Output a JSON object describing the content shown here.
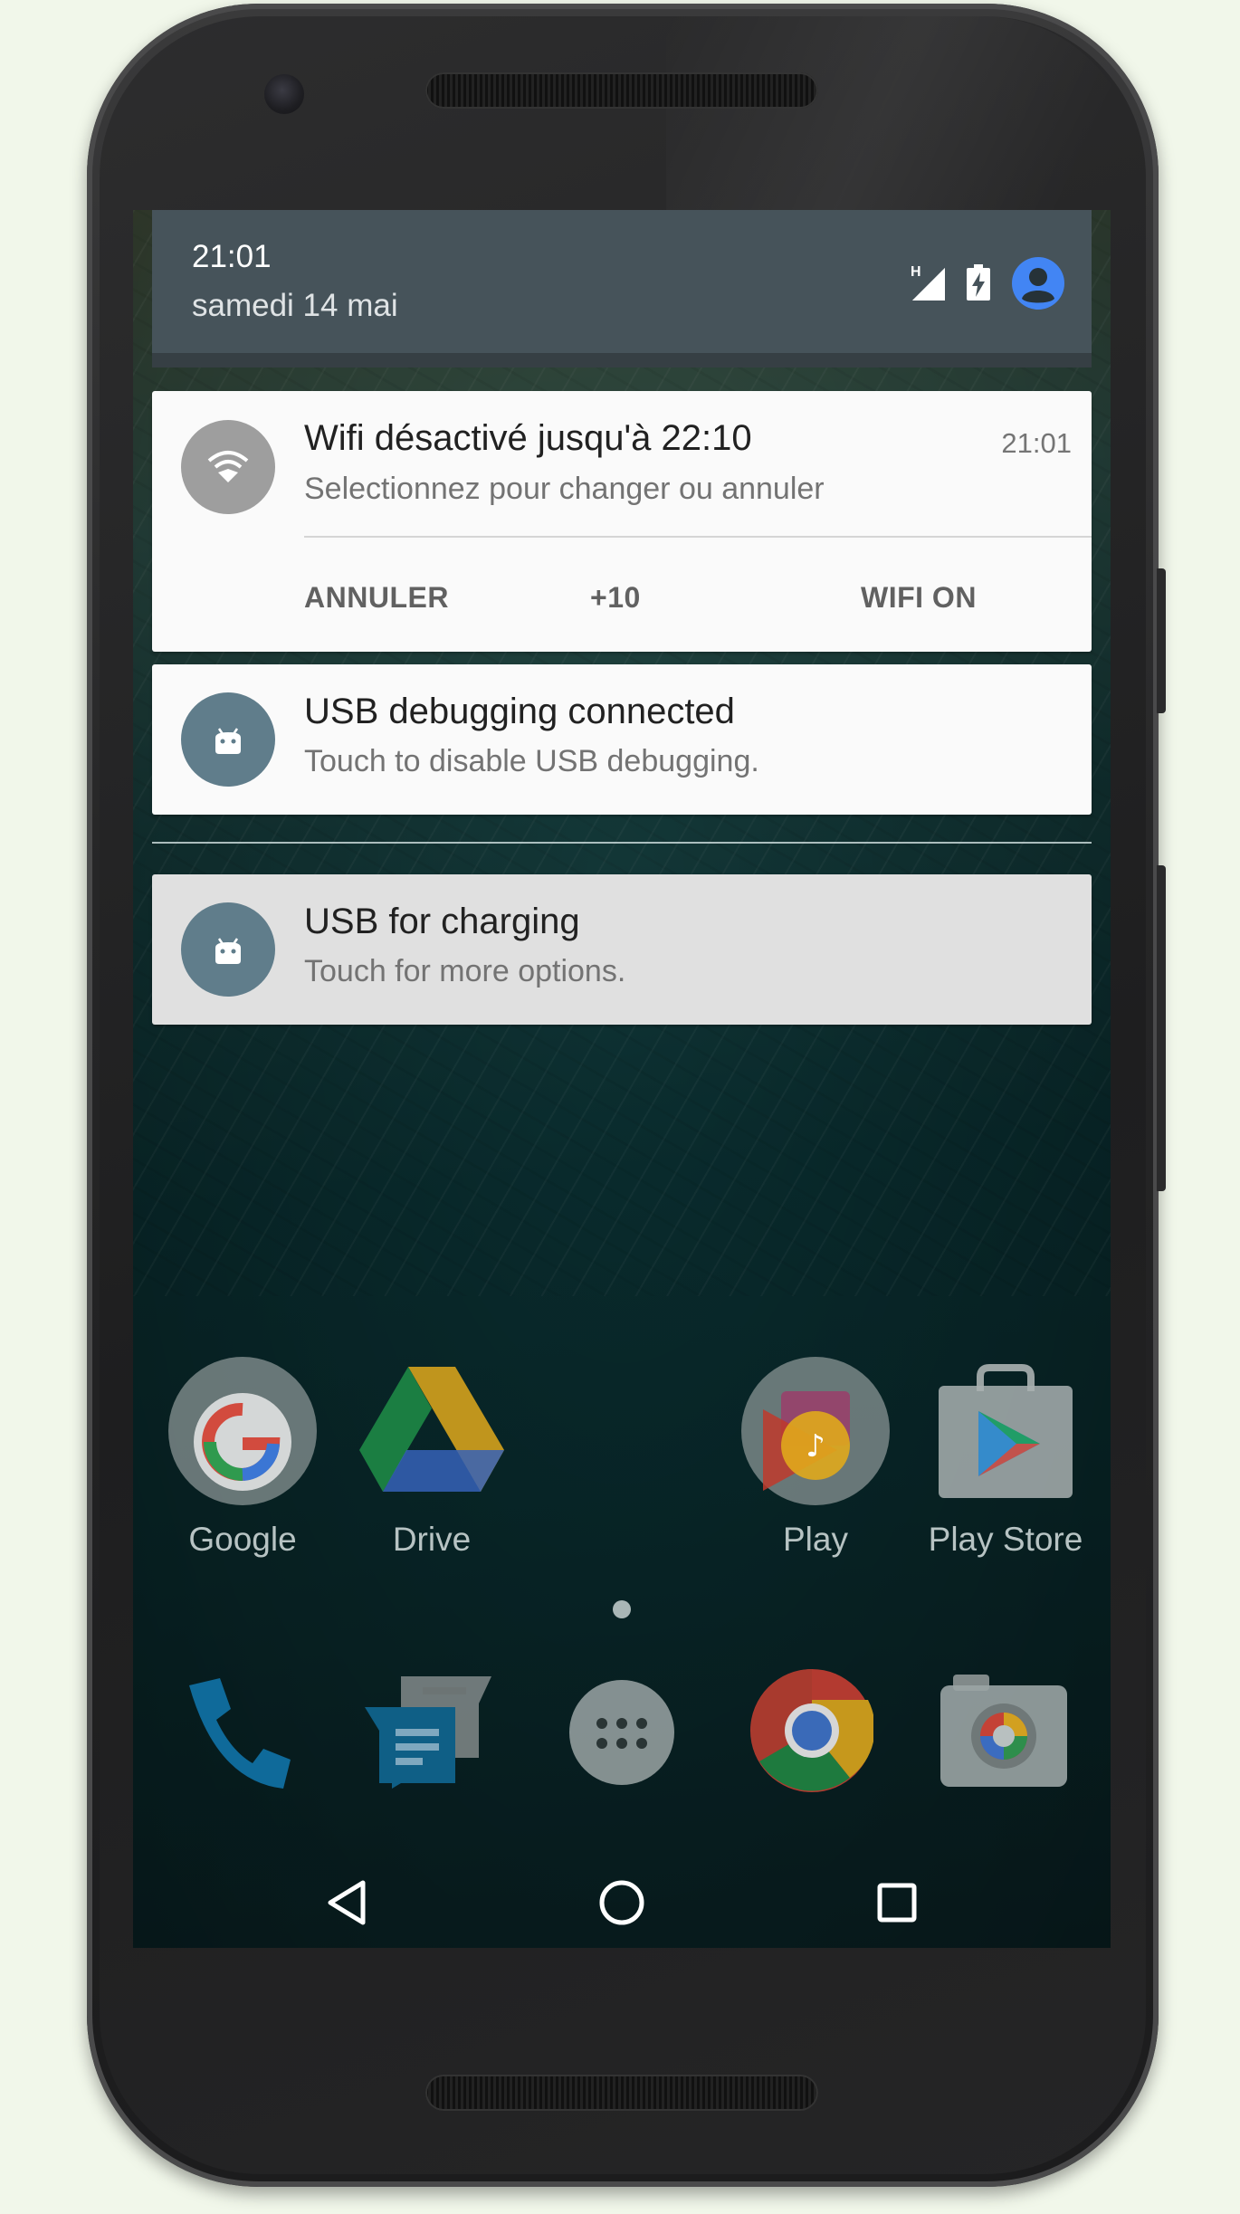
{
  "status_bar": {
    "time": "21:01",
    "date": "samedi 14 mai",
    "network_type": "H",
    "icons": [
      "signal-icon",
      "battery-charging-icon",
      "account-avatar-icon"
    ]
  },
  "notifications": [
    {
      "title": "Wifi désactivé jusqu'à 22:10",
      "text": "Selectionnez pour changer ou annuler",
      "time": "21:01",
      "icon": "wifi-off-icon",
      "actions": [
        "ANNULER",
        "+10",
        "WIFI ON"
      ]
    },
    {
      "title": "USB debugging connected",
      "text": "Touch to disable USB debugging.",
      "icon": "android-icon"
    },
    {
      "title": "USB for charging",
      "text": "Touch for more options.",
      "icon": "android-icon"
    }
  ],
  "home_apps": [
    {
      "label": "Google",
      "icon": "google-folder-icon"
    },
    {
      "label": "Drive",
      "icon": "drive-icon"
    },
    {
      "label": "Play",
      "icon": "play-folder-icon"
    },
    {
      "label": "Play Store",
      "icon": "play-store-icon"
    }
  ],
  "dock": [
    "phone-icon",
    "messenger-icon",
    "app-drawer-icon",
    "chrome-icon",
    "camera-icon"
  ],
  "navigation": [
    "back-icon",
    "home-icon",
    "recents-icon"
  ],
  "colors": {
    "header": "#46535a",
    "card": "#fafafa",
    "card_dim": "#e0e0e0",
    "icon_grey": "#9e9e9e",
    "icon_android": "#607d8b",
    "avatar_blue": "#4285f4"
  }
}
